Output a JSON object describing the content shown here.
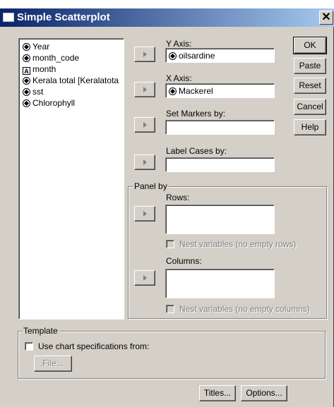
{
  "window": {
    "title": "Simple Scatterplot",
    "close_glyph": "✕"
  },
  "variables": [
    {
      "label": "Year",
      "type": "scale"
    },
    {
      "label": "month_code",
      "type": "scale"
    },
    {
      "label": "month",
      "type": "string"
    },
    {
      "label": "Kerala total [Keralatota",
      "type": "scale"
    },
    {
      "label": "sst",
      "type": "scale"
    },
    {
      "label": "Chlorophyll",
      "type": "scale"
    }
  ],
  "fields": {
    "y_axis": {
      "label": "Y Axis:",
      "value": "oilsardine"
    },
    "x_axis": {
      "label": "X Axis:",
      "value": "Mackerel"
    },
    "set_markers": {
      "label": "Set Markers by:",
      "value": ""
    },
    "label_cases": {
      "label": "Label Cases by:",
      "value": ""
    }
  },
  "panel": {
    "title": "Panel by",
    "rows_label": "Rows:",
    "rows_nest": "Nest variables (no empty rows)",
    "columns_label": "Columns:",
    "columns_nest": "Nest variables (no empty columns)"
  },
  "buttons": {
    "ok": "OK",
    "paste": "Paste",
    "reset": "Reset",
    "cancel": "Cancel",
    "help": "Help",
    "titles": "Titles...",
    "options": "Options..."
  },
  "template": {
    "title": "Template",
    "use_chart_spec": "Use chart specifications from:",
    "file_button": "File..."
  }
}
